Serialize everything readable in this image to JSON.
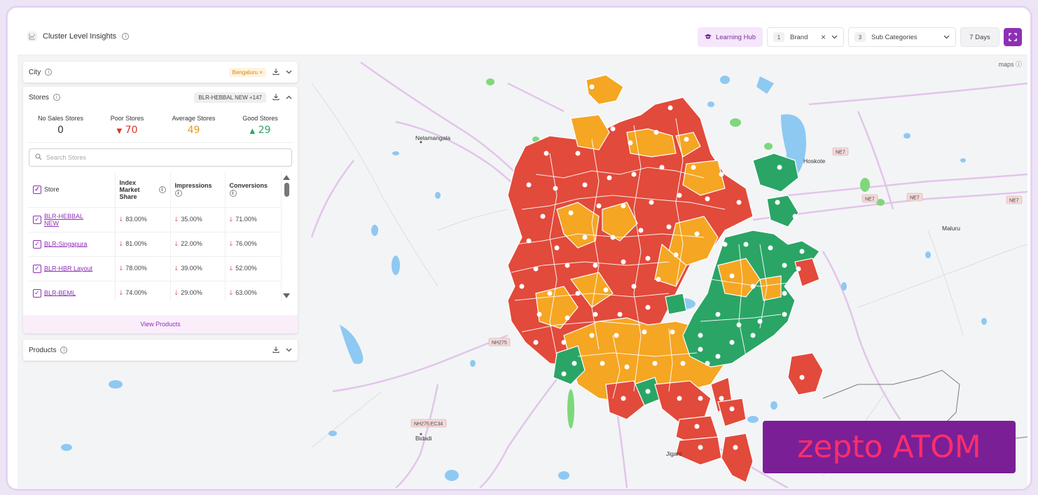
{
  "topbar": {
    "title": "Cluster Level Insights",
    "learning_hub": "Learning Hub",
    "brand_count": "1",
    "brand_label": "Brand",
    "subcat_count": "3",
    "subcat_label": "Sub Categories",
    "days_label": "7 Days"
  },
  "map": {
    "provider": "maps",
    "labels": {
      "nelamangala": "Nelamangala",
      "hoskote": "Hoskote",
      "maluru": "Maluru",
      "bidadi": "Bidadi",
      "jigani": "Jigani",
      "ne7_1": "NE7",
      "ne7_2": "NE7",
      "ne7_3": "NE7",
      "ne7_4": "NE7",
      "nh275": "NH275",
      "nh275ec34": "NH275;EC34"
    },
    "colors": {
      "poor": "#e24a3b",
      "average": "#f5a623",
      "good": "#2aa566"
    }
  },
  "city_card": {
    "title": "City",
    "selected": "Bengaluru"
  },
  "stores_card": {
    "title": "Stores",
    "selected": "BLR-HEBBAL NEW +147",
    "stats": [
      {
        "label": "No Sales Stores",
        "value": "0",
        "color": "#333333"
      },
      {
        "label": "Poor Stores",
        "value": "70",
        "color": "#d9342b"
      },
      {
        "label": "Average Stores",
        "value": "49",
        "color": "#e59a1a"
      },
      {
        "label": "Good Stores",
        "value": "29",
        "color": "#2aa566"
      }
    ],
    "search_placeholder": "Search Stores",
    "columns": [
      "Store",
      "Index Market Share",
      "Impressions",
      "Conversions"
    ],
    "rows": [
      {
        "store": "BLR-HEBBAL NEW",
        "index": "83.00%",
        "impressions": "35.00%",
        "conversions": "71.00%"
      },
      {
        "store": "BLR-Singapura",
        "index": "81.00%",
        "impressions": "22.00%",
        "conversions": "76.00%"
      },
      {
        "store": "BLR-HBR Layout",
        "index": "78.00%",
        "impressions": "39.00%",
        "conversions": "52.00%"
      },
      {
        "store": "BLR-BEML",
        "index": "74.00%",
        "impressions": "29.00%",
        "conversions": "63.00%"
      }
    ],
    "view_products": "View Products"
  },
  "products_card": {
    "title": "Products"
  },
  "brand_banner": {
    "text": "zepto ATOM"
  }
}
